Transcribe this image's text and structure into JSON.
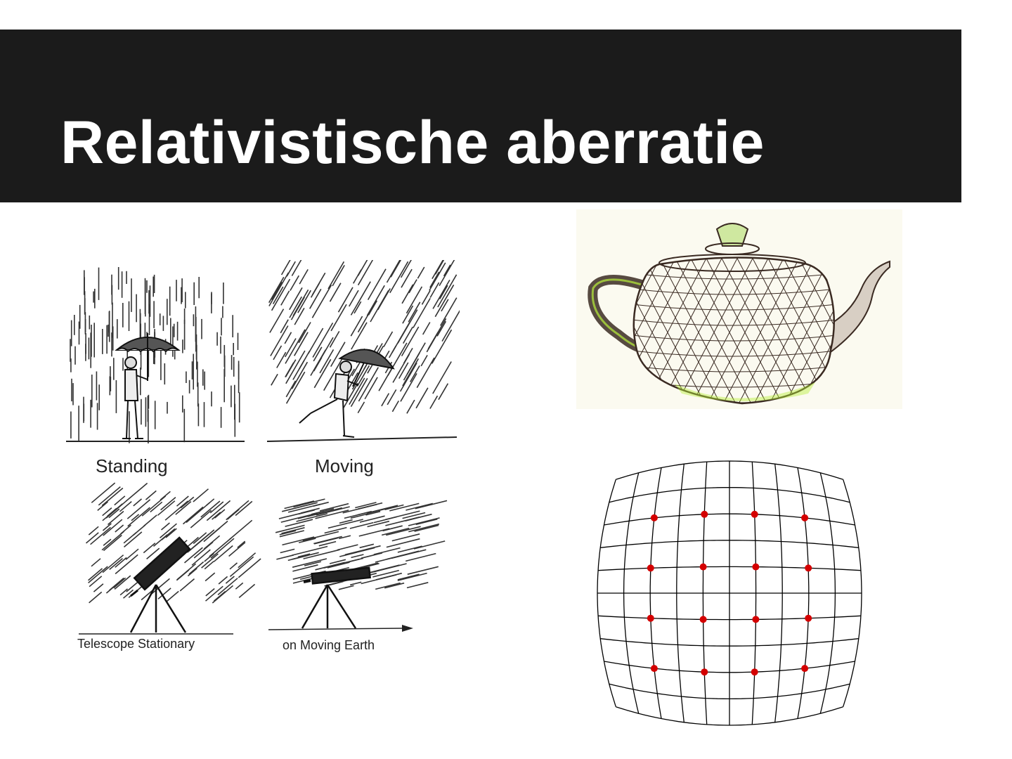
{
  "slide": {
    "title": "Relativistische aberratie"
  },
  "illustration_rain": {
    "captions": {
      "standing": "Standing",
      "moving": "Moving",
      "telescope_stationary": "Telescope Stationary",
      "moving_earth": "on Moving Earth"
    }
  },
  "illustration_teapot": {
    "colors": {
      "background": "#fbfaf0",
      "wire": "#3a2a22",
      "highlight": "#b8f03a"
    }
  },
  "illustration_grid": {
    "colors": {
      "lines": "#000000",
      "dots": "#d40000"
    }
  }
}
